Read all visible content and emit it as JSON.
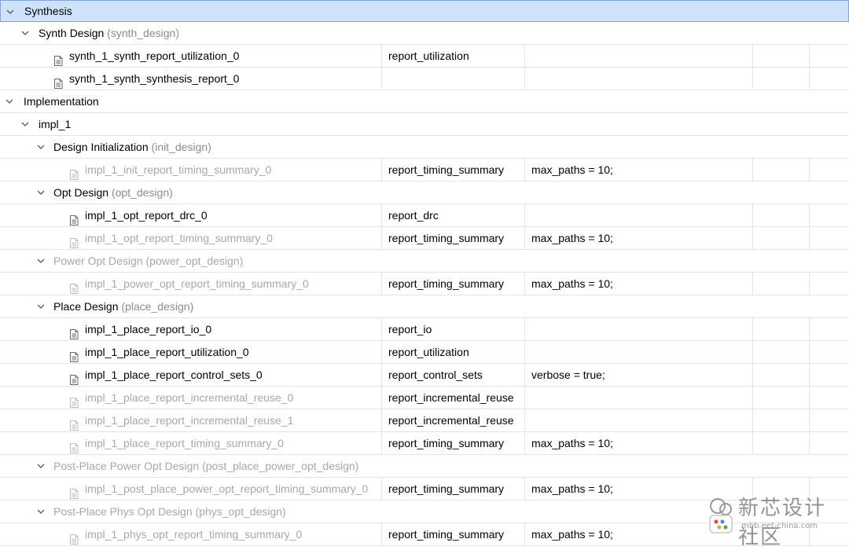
{
  "rows": [
    {
      "type": "group",
      "level": 0,
      "name": "Synthesis",
      "paren": "",
      "selected": true,
      "dim": false
    },
    {
      "type": "group",
      "level": 1,
      "name": "Synth Design",
      "paren": "(synth_design)",
      "dim": false
    },
    {
      "type": "report",
      "level": 2,
      "name": "synth_1_synth_report_utilization_0",
      "command": "report_utilization",
      "options": "",
      "dim": false
    },
    {
      "type": "report",
      "level": 2,
      "name": "synth_1_synth_synthesis_report_0",
      "command": "",
      "options": "",
      "dim": false
    },
    {
      "type": "group",
      "level": 0,
      "name": "Implementation",
      "paren": "",
      "dim": false
    },
    {
      "type": "group",
      "level": 1,
      "name": "impl_1",
      "paren": "",
      "dim": false
    },
    {
      "type": "group",
      "level": 2,
      "name": "Design Initialization",
      "paren": "(init_design)",
      "dim": false
    },
    {
      "type": "report",
      "level": 3,
      "name": "impl_1_init_report_timing_summary_0",
      "command": "report_timing_summary",
      "options": "max_paths = 10;",
      "dim": true
    },
    {
      "type": "group",
      "level": 2,
      "name": "Opt Design",
      "paren": "(opt_design)",
      "dim": false
    },
    {
      "type": "report",
      "level": 3,
      "name": "impl_1_opt_report_drc_0",
      "command": "report_drc",
      "options": "",
      "dim": false
    },
    {
      "type": "report",
      "level": 3,
      "name": "impl_1_opt_report_timing_summary_0",
      "command": "report_timing_summary",
      "options": "max_paths = 10;",
      "dim": true
    },
    {
      "type": "group",
      "level": 2,
      "name": "Power Opt Design",
      "paren": "(power_opt_design)",
      "dim": true
    },
    {
      "type": "report",
      "level": 3,
      "name": "impl_1_power_opt_report_timing_summary_0",
      "command": "report_timing_summary",
      "options": "max_paths = 10;",
      "dim": true
    },
    {
      "type": "group",
      "level": 2,
      "name": "Place Design",
      "paren": "(place_design)",
      "dim": false
    },
    {
      "type": "report",
      "level": 3,
      "name": "impl_1_place_report_io_0",
      "command": "report_io",
      "options": "",
      "dim": false
    },
    {
      "type": "report",
      "level": 3,
      "name": "impl_1_place_report_utilization_0",
      "command": "report_utilization",
      "options": "",
      "dim": false
    },
    {
      "type": "report",
      "level": 3,
      "name": "impl_1_place_report_control_sets_0",
      "command": "report_control_sets",
      "options": "verbose = true;",
      "dim": false
    },
    {
      "type": "report",
      "level": 3,
      "name": "impl_1_place_report_incremental_reuse_0",
      "command": "report_incremental_reuse",
      "options": "",
      "dim": true
    },
    {
      "type": "report",
      "level": 3,
      "name": "impl_1_place_report_incremental_reuse_1",
      "command": "report_incremental_reuse",
      "options": "",
      "dim": true
    },
    {
      "type": "report",
      "level": 3,
      "name": "impl_1_place_report_timing_summary_0",
      "command": "report_timing_summary",
      "options": "max_paths = 10;",
      "dim": true
    },
    {
      "type": "group",
      "level": 2,
      "name": "Post-Place Power Opt Design",
      "paren": "(post_place_power_opt_design)",
      "dim": true
    },
    {
      "type": "report",
      "level": 3,
      "name": "impl_1_post_place_power_opt_report_timing_summary_0",
      "command": "report_timing_summary",
      "options": "max_paths = 10;",
      "dim": true
    },
    {
      "type": "group",
      "level": 2,
      "name": "Post-Place Phys Opt Design",
      "paren": "(phys_opt_design)",
      "dim": true
    },
    {
      "type": "report",
      "level": 3,
      "name": "impl_1_phys_opt_report_timing_summary_0",
      "command": "report_timing_summary",
      "options": "max_paths = 10;",
      "dim": true
    }
  ],
  "watermark": {
    "text": "新芯设计",
    "text2": "社区",
    "sub": "mbb.eet-china.com"
  }
}
